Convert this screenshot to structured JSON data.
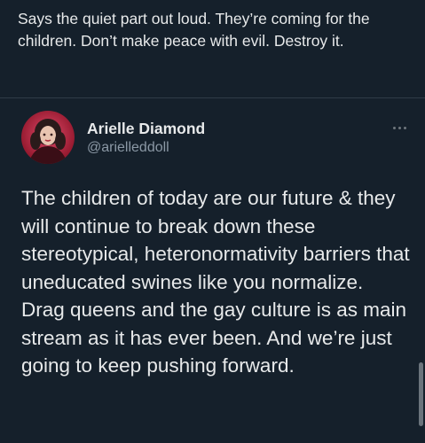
{
  "quote_tweet": {
    "text": "Says the quiet part out loud. They’re coming for the children. Don’t make peace with evil. Destroy it."
  },
  "embedded_tweet": {
    "author": {
      "display_name": "Arielle Diamond",
      "handle": "@arielleddoll",
      "avatar_icon": "profile-photo"
    },
    "more_icon": "ellipsis-icon",
    "text": "The children of today are our future & they will continue to break down these stereotypical, heteronormativity barriers that uneducated swines like you normalize. Drag queens and the gay culture is as main stream as it has ever been. And we’re just going to keep pushing forward."
  },
  "colors": {
    "background": "#15202b",
    "text_primary": "#e7e9ea",
    "text_secondary": "#8b98a5",
    "divider": "#2f3b47"
  }
}
